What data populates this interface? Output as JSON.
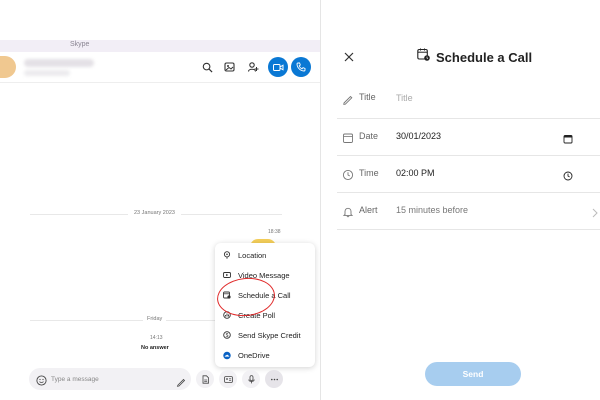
{
  "app": {
    "title": "Skype"
  },
  "chat": {
    "day_separator": "23 January 2023",
    "message_time": "18:38",
    "day_separator_2": "Friday",
    "call_time": "14:13",
    "call_status": "No answer",
    "composer_placeholder": "Type a message"
  },
  "menu": {
    "items": [
      {
        "label": "Location",
        "icon": "location-icon"
      },
      {
        "label": "Video Message",
        "icon": "video-message-icon"
      },
      {
        "label": "Schedule a Call",
        "icon": "schedule-call-icon"
      },
      {
        "label": "Create Poll",
        "icon": "poll-icon"
      },
      {
        "label": "Send Skype Credit",
        "icon": "credit-icon"
      },
      {
        "label": "OneDrive",
        "icon": "onedrive-icon"
      }
    ]
  },
  "schedule": {
    "title": "Schedule a Call",
    "title_label": "Title",
    "title_placeholder": "Title",
    "date_label": "Date",
    "date_value": "30/01/2023",
    "time_label": "Time",
    "time_value": "02:00 PM",
    "alert_label": "Alert",
    "alert_value": "15 minutes before",
    "send_label": "Send"
  },
  "colors": {
    "accent": "#0a78d4",
    "send_disabled": "#a7cdef",
    "highlight": "#e02a2a"
  }
}
